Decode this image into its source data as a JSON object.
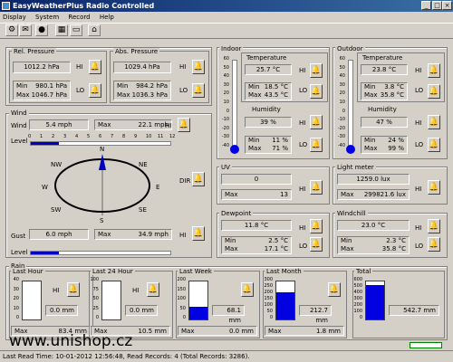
{
  "window": {
    "title": "EasyWeatherPlus Radio Controlled"
  },
  "menu": [
    "Display",
    "System",
    "Record",
    "Help"
  ],
  "pressure": {
    "rel_label": "Rel. Pressure",
    "rel_value": "1012.2 hPa",
    "rel_min": "980.1 hPa",
    "rel_max": "1046.7 hPa",
    "abs_label": "Abs. Pressure",
    "abs_value": "1029.4 hPa",
    "abs_min": "984.2 hPa",
    "abs_max": "1036.3 hPa"
  },
  "labels": {
    "hi": "HI",
    "lo": "LO",
    "min": "Min",
    "max": "Max",
    "dir": "DIR",
    "level": "Level",
    "wind_lbl": "Wind",
    "gust_lbl": "Gust",
    "temperature": "Temperature",
    "humidity": "Humidity"
  },
  "indoor": {
    "label": "Indoor",
    "temp": "25.7 °C",
    "temp_min": "18.5 °C",
    "temp_max": "43.5 °C",
    "hum": "39 %",
    "hum_min": "11 %",
    "hum_max": "71 %",
    "thermo_level": 0.0
  },
  "outdoor": {
    "label": "Outdoor",
    "temp": "23.8 °C",
    "temp_min": "3.8 °C",
    "temp_max": "35.8 °C",
    "hum": "47 %",
    "hum_min": "24 %",
    "hum_max": "99 %",
    "thermo_level": 0.0
  },
  "thermo_ticks": [
    "60",
    "50",
    "40",
    "30",
    "20",
    "10",
    "0",
    "-10",
    "-20",
    "-30",
    "-40"
  ],
  "wind": {
    "title": "Wind",
    "wind_value": "5.4 mph",
    "wind_max": "22.1 mph",
    "gust_value": "6.0 mph",
    "gust_max": "34.9 mph",
    "wind_level": 3,
    "gust_level": 3,
    "scale": [
      "0",
      "1",
      "2",
      "3",
      "4",
      "5",
      "6",
      "7",
      "8",
      "9",
      "10",
      "11",
      "12"
    ],
    "compass": {
      "n": "N",
      "s": "S",
      "e": "E",
      "w": "W",
      "ne": "NE",
      "nw": "NW",
      "se": "SE",
      "sw": "SW"
    }
  },
  "uv": {
    "label": "UV",
    "value": "0",
    "max": "13"
  },
  "light": {
    "label": "Light meter",
    "value": "1259.0 lux",
    "max": "299821.6 lux"
  },
  "dewpoint": {
    "label": "Dewpoint",
    "value": "11.8 °C",
    "min": "2.5 °C",
    "max": "17.1 °C"
  },
  "windchill": {
    "label": "Windchill",
    "value": "23.0 °C",
    "min": "2.3 °C",
    "max": "35.8 °C"
  },
  "rain": {
    "title": "Rain",
    "hour": {
      "label": "Last Hour",
      "value": "0.0 mm",
      "max": "83.4 mm",
      "ticks": [
        "40",
        "30",
        "20",
        "10",
        "0"
      ],
      "fill": 0.0
    },
    "day": {
      "label": "Last 24 Hour",
      "value": "0.0 mm",
      "max": "10.5 mm",
      "ticks": [
        "100",
        "75",
        "50",
        "25",
        "0"
      ],
      "fill": 0.0
    },
    "week": {
      "label": "Last Week",
      "value": "68.1 mm",
      "max": "0.0 mm",
      "ticks": [
        "200",
        "150",
        "100",
        "50",
        "0"
      ],
      "fill": 0.34
    },
    "month": {
      "label": "Last Month",
      "value": "212.7 mm",
      "max": "1.8 mm",
      "ticks": [
        "300",
        "250",
        "200",
        "150",
        "100",
        "50",
        "0"
      ],
      "fill": 0.71
    },
    "total": {
      "label": "Total",
      "value": "542.7 mm",
      "max": "",
      "ticks": [
        "600",
        "500",
        "400",
        "300",
        "200",
        "100",
        "0"
      ],
      "fill": 0.9
    }
  },
  "watermark": "www.unishop.cz",
  "status": "Last Read Time: 10-01-2012 12:56:48, Read Records: 4 (Total Records: 3286)."
}
